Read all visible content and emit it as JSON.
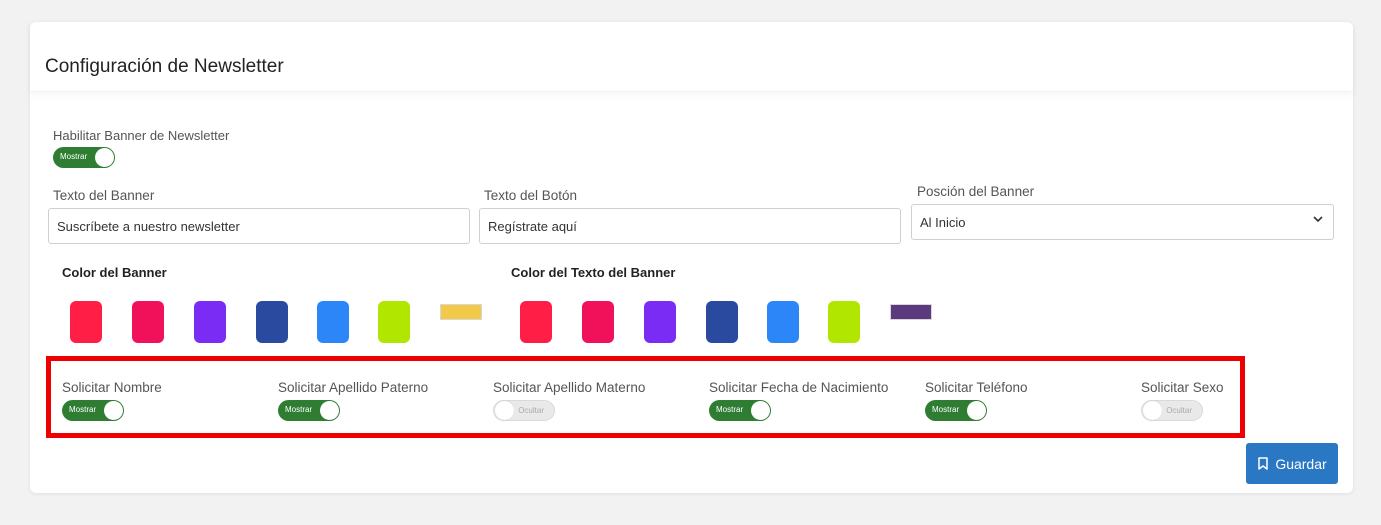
{
  "card": {
    "title": "Configuración de Newsletter"
  },
  "banner_toggle": {
    "label": "Habilitar Banner de Newsletter",
    "state_label": "Mostrar",
    "on": true
  },
  "fields": {
    "banner_text": {
      "label": "Texto del Banner",
      "value": "Suscríbete a nuestro newsletter"
    },
    "button_text": {
      "label": "Texto del Botón",
      "value": "Regístrate aquí"
    },
    "banner_position": {
      "label": "Posción del Banner",
      "value": "Al Inicio"
    }
  },
  "colors": {
    "banner": {
      "label": "Color del Banner",
      "swatches": [
        "#ff1e46",
        "#f0115a",
        "#7a2cf5",
        "#2a4aa0",
        "#2d86f8",
        "#b0e600"
      ],
      "selected": "#f3c94a"
    },
    "text": {
      "label": "Color del Texto del Banner",
      "swatches": [
        "#ff1e46",
        "#f0115a",
        "#7a2cf5",
        "#2a4aa0",
        "#2d86f8",
        "#b0e600"
      ],
      "selected": "#5b3a7e"
    }
  },
  "requests": [
    {
      "label": "Solicitar Nombre",
      "state_label": "Mostrar",
      "on": true
    },
    {
      "label": "Solicitar Apellido Paterno",
      "state_label": "Mostrar",
      "on": true
    },
    {
      "label": "Solicitar Apellido Materno",
      "state_label": "Ocultar",
      "on": false
    },
    {
      "label": "Solicitar Fecha de Nacimiento",
      "state_label": "Mostrar",
      "on": true
    },
    {
      "label": "Solicitar Teléfono",
      "state_label": "Mostrar",
      "on": true
    },
    {
      "label": "Solicitar Sexo",
      "state_label": "Ocultar",
      "on": false
    }
  ],
  "actions": {
    "save_label": "Guardar",
    "save_icon": "bookmark-icon"
  }
}
